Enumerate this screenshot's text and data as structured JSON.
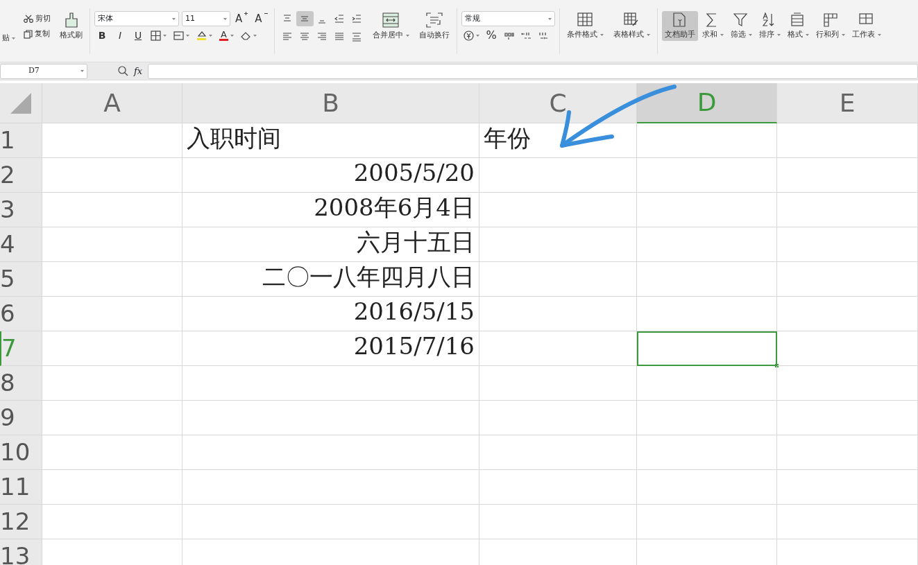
{
  "ribbon": {
    "clipboard": {
      "paste": "贴",
      "cut": "剪切",
      "copy": "复制",
      "format_painter": "格式刷"
    },
    "font": {
      "name": "宋体",
      "size": "11",
      "size_buttons": [
        {
          "label": "A",
          "kind": "grow"
        },
        {
          "label": "A",
          "kind": "shrink"
        }
      ],
      "style_buttons": [
        {
          "label": "B",
          "kind": "bold"
        },
        {
          "label": "I",
          "kind": "italic"
        },
        {
          "label": "U",
          "kind": "underline"
        }
      ],
      "font_color_letter": "A"
    },
    "alignment": {
      "buttons": [
        {
          "kind": "top",
          "selected": false
        },
        {
          "kind": "middle",
          "selected": true
        },
        {
          "kind": "bottom",
          "selected": false
        },
        {
          "kind": "outdent",
          "selected": false
        },
        {
          "kind": "indent",
          "selected": false
        },
        {
          "kind": "left",
          "selected": false
        },
        {
          "kind": "center",
          "selected": false
        },
        {
          "kind": "right",
          "selected": false
        },
        {
          "kind": "justify",
          "selected": false
        },
        {
          "kind": "distribute",
          "selected": false
        }
      ],
      "merge": "合并居中",
      "wrap": "自动换行"
    },
    "number": {
      "format": "常规",
      "percent": "%"
    },
    "tools": [
      {
        "label": "条件格式",
        "kind": "conditional",
        "dropdown": true,
        "selected": false
      },
      {
        "label": "表格样式",
        "kind": "tablestyle",
        "dropdown": true,
        "selected": false
      },
      {
        "label": "文档助手",
        "kind": "assistant",
        "dropdown": false,
        "selected": true
      },
      {
        "label": "求和",
        "kind": "sum",
        "dropdown": true,
        "selected": false
      },
      {
        "label": "筛选",
        "kind": "filter",
        "dropdown": true,
        "selected": false
      },
      {
        "label": "排序",
        "kind": "sort",
        "dropdown": true,
        "selected": false
      },
      {
        "label": "格式",
        "kind": "format",
        "dropdown": true,
        "selected": false
      },
      {
        "label": "行和列",
        "kind": "rowcol",
        "dropdown": true,
        "selected": false
      },
      {
        "label": "工作表",
        "kind": "sheet",
        "dropdown": true,
        "selected": false
      }
    ]
  },
  "formula_bar": {
    "name_box": "D7",
    "fx": "fx"
  },
  "sheet": {
    "columns": [
      {
        "label": "A",
        "selected": false
      },
      {
        "label": "B",
        "selected": false
      },
      {
        "label": "C",
        "selected": false
      },
      {
        "label": "D",
        "selected": true
      },
      {
        "label": "E",
        "selected": false
      }
    ],
    "rows": [
      {
        "label": "1",
        "selected": false,
        "cells": {
          "B": {
            "text": "入职时间",
            "kind": "text"
          },
          "C": {
            "text": "年份",
            "kind": "text"
          }
        }
      },
      {
        "label": "2",
        "selected": false,
        "cells": {
          "B": {
            "text": "2005/5/20",
            "kind": "date"
          }
        }
      },
      {
        "label": "3",
        "selected": false,
        "cells": {
          "B": {
            "text": "2008年6月4日",
            "kind": "date"
          }
        }
      },
      {
        "label": "4",
        "selected": false,
        "cells": {
          "B": {
            "text": "六月十五日",
            "kind": "date"
          }
        }
      },
      {
        "label": "5",
        "selected": false,
        "cells": {
          "B": {
            "text": "二〇一八年四月八日",
            "kind": "date"
          }
        }
      },
      {
        "label": "6",
        "selected": false,
        "cells": {
          "B": {
            "text": "2016/5/15",
            "kind": "date"
          }
        }
      },
      {
        "label": "7",
        "selected": true,
        "cells": {
          "B": {
            "text": "2015/7/16",
            "kind": "date"
          }
        }
      },
      {
        "label": "8",
        "selected": false
      },
      {
        "label": "9",
        "selected": false
      },
      {
        "label": "10",
        "selected": false
      },
      {
        "label": "11",
        "selected": false
      },
      {
        "label": "12",
        "selected": false
      },
      {
        "label": "13",
        "selected": false
      }
    ]
  }
}
